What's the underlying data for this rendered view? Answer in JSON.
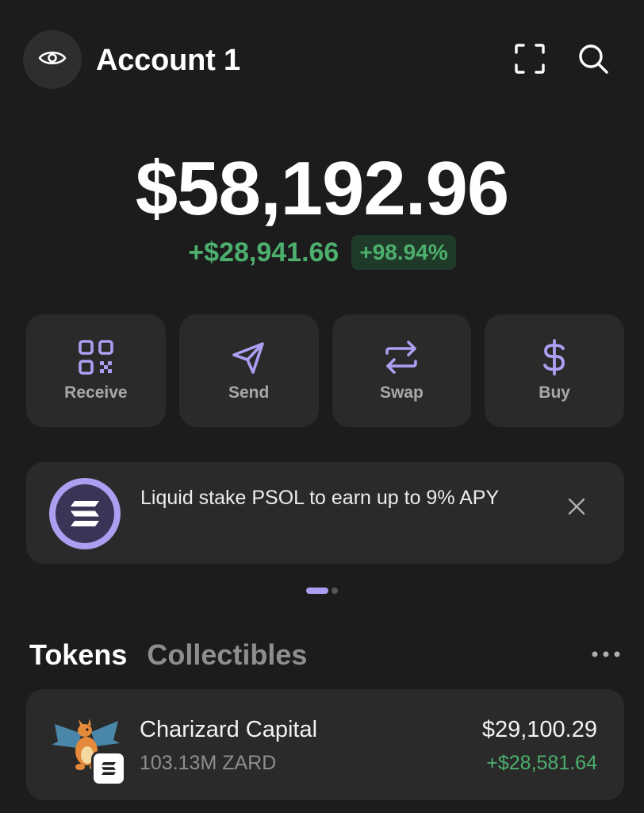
{
  "header": {
    "account_name": "Account 1",
    "left_icon": "eye-icon",
    "right_icons": [
      "scan-icon",
      "search-icon"
    ]
  },
  "balance": {
    "total": "$58,192.96",
    "change_amount": "+$28,941.66",
    "change_percent": "+98.94%"
  },
  "actions": [
    {
      "label": "Receive",
      "icon": "qr-code-icon"
    },
    {
      "label": "Send",
      "icon": "send-icon"
    },
    {
      "label": "Swap",
      "icon": "swap-icon"
    },
    {
      "label": "Buy",
      "icon": "dollar-icon"
    }
  ],
  "promo": {
    "text": "Liquid stake PSOL to earn up to 9% APY",
    "icon": "solana-logo-icon",
    "close_icon": "close-icon"
  },
  "pager": {
    "pages": 2,
    "active_index": 0
  },
  "tabs": [
    {
      "label": "Tokens",
      "active": true
    },
    {
      "label": "Collectibles",
      "active": false
    }
  ],
  "more_icon": "more-horizontal-icon",
  "tokens": [
    {
      "name": "Charizard Capital",
      "amount": "103.13M ZARD",
      "value": "$29,100.29",
      "change": "+$28,581.64",
      "icon": "charizard-token-icon",
      "chain_badge": "solana-badge-icon"
    }
  ],
  "colors": {
    "background": "#1c1c1c",
    "card": "#2a2a2a",
    "accent": "#ab9ff2",
    "positive": "#4caf6d",
    "positive_bg": "#1f3a28",
    "muted_text": "#8e8e8e"
  }
}
